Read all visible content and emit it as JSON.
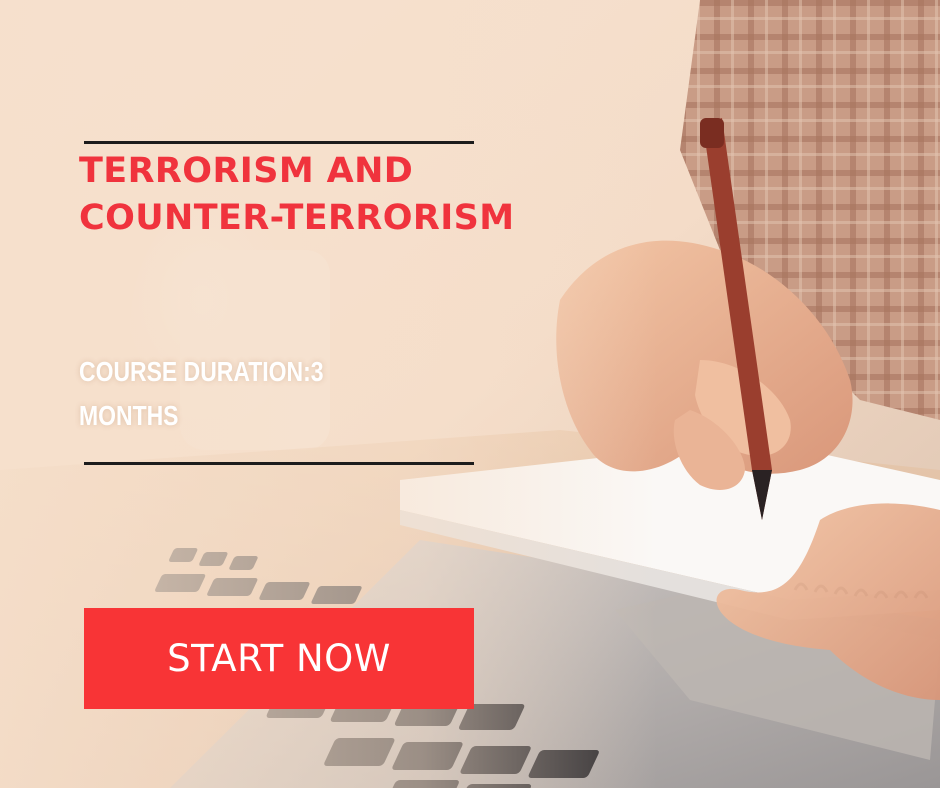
{
  "title": {
    "line1": "TERRORISM AND",
    "line2": "COUNTER-TERRORISM"
  },
  "duration": {
    "line1": "COURSE DURATION:3",
    "line2": "MONTHS"
  },
  "cta": {
    "label": "START NOW"
  },
  "colors": {
    "title_red": "#f0333d",
    "button_red": "#f83436",
    "rule": "#1c1c1c",
    "duration_text": "#ffffff"
  },
  "background_photo": {
    "icon": "hand-writing-notebook-laptop-photo"
  }
}
